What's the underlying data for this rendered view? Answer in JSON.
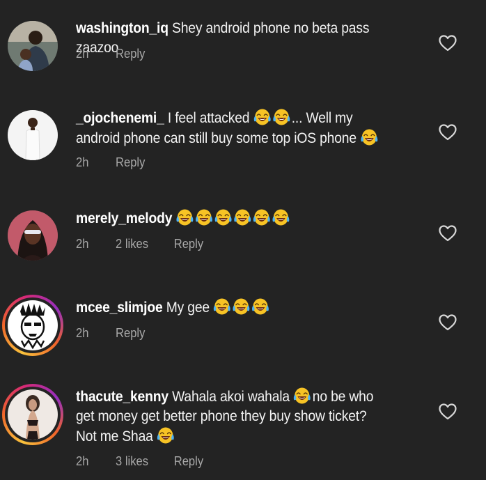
{
  "comments": [
    {
      "username": "washington_iq",
      "text": "Shey android phone no beta pass zaazoo",
      "time": "2h",
      "likes": "",
      "reply": "Reply"
    },
    {
      "username": "_ojochenemi_",
      "text_a": "I feel attacked",
      "text_b": "... Well my android phone can still buy some top iOS phone",
      "time": "2h",
      "likes": "",
      "reply": "Reply"
    },
    {
      "username": "merely_melody",
      "text": "",
      "time": "2h",
      "likes": "2 likes",
      "reply": "Reply"
    },
    {
      "username": "mcee_slimjoe",
      "text": "My gee",
      "time": "2h",
      "likes": "",
      "reply": "Reply"
    },
    {
      "username": "thacute_kenny",
      "text_a": "Wahala akoi wahala",
      "text_b": "no be who get money get better phone they buy show ticket?  Not me Shaa",
      "time": "2h",
      "likes": "3 likes",
      "reply": "Reply"
    }
  ],
  "icons": {
    "emoji": "face-with-tears-of-joy-icon",
    "like": "heart-outline-icon"
  },
  "colors": {
    "background": "#232323",
    "meta_text": "#a8a8a8",
    "text": "#f2f2f2"
  }
}
